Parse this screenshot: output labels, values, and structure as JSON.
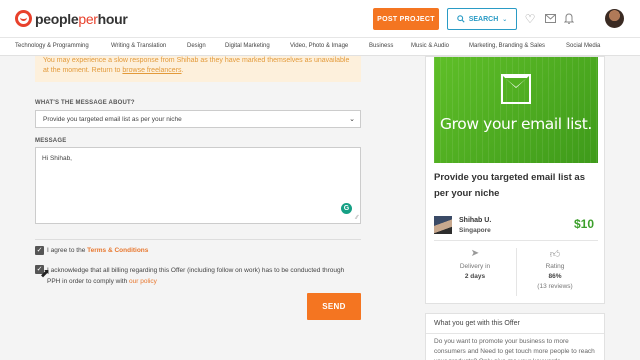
{
  "header": {
    "logo": {
      "people": "people",
      "per": "per",
      "hour": "hour"
    },
    "post_project": "POST PROJECT",
    "search": "SEARCH",
    "icons": [
      "search-icon",
      "chevron-down-icon",
      "heart-icon",
      "mail-icon",
      "bell-icon"
    ]
  },
  "categories": [
    "Technology & Programming",
    "Writing & Translation",
    "Design",
    "Digital Marketing",
    "Video, Photo & Image",
    "Business",
    "Music & Audio",
    "Marketing, Branding & Sales",
    "Social Media"
  ],
  "notice": {
    "text": "You may experience a slow response from Shihab as they have marked themselves as unavailable at the moment. Return to",
    "link": "browse freelancers",
    "end": "."
  },
  "form": {
    "about_label": "WHAT'S THE MESSAGE ABOUT?",
    "about_value": "Provide you targeted email list as per your niche",
    "message_label": "MESSAGE",
    "message_value": "Hi Shihab,",
    "agree_prefix": "I agree to the",
    "agree_link": "Terms & Conditions",
    "billing_text": "I acknowledge that all billing regarding this Offer (including follow on work) has to be conducted through PPH in order to comply with",
    "billing_link": "our policy",
    "send": "SEND"
  },
  "offer": {
    "banner_text": "Grow your email list.",
    "title": "Provide you targeted email list as per your niche",
    "seller_name": "Shihab U.",
    "seller_location": "Singapore",
    "price": "$10",
    "delivery_label": "Delivery in",
    "delivery_value": "2 days",
    "rating_label": "Rating",
    "rating_value": "86%",
    "rating_reviews": "(13 reviews)"
  },
  "offer_info": {
    "title": "What you get with this Offer",
    "body": "Do you want to promote your business to more consumers and Need to get touch more people to reach your products? Only give me your keywords"
  },
  "colors": {
    "accent_orange": "#f47521",
    "search_blue": "#2a9bc5",
    "price_green": "#3c9f2b",
    "banner_green": "#53b022"
  }
}
